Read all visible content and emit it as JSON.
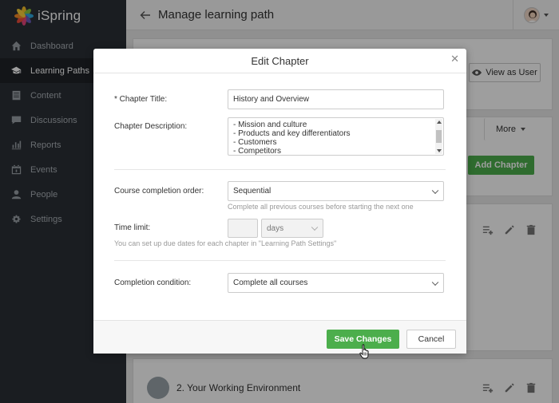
{
  "app": {
    "logo_text": "iSpring",
    "page_title": "Manage learning path"
  },
  "sidebar": {
    "items": [
      {
        "label": "Dashboard",
        "icon": "home-icon"
      },
      {
        "label": "Learning Paths",
        "icon": "graduation-cap-icon",
        "active": true
      },
      {
        "label": "Content",
        "icon": "document-icon"
      },
      {
        "label": "Discussions",
        "icon": "chat-icon"
      },
      {
        "label": "Reports",
        "icon": "bar-chart-icon"
      },
      {
        "label": "Events",
        "icon": "calendar-icon"
      },
      {
        "label": "People",
        "icon": "person-icon"
      },
      {
        "label": "Settings",
        "icon": "gear-icon"
      }
    ]
  },
  "background": {
    "view_as_user": "View as User",
    "more": "More",
    "add_chapter": "Add Chapter",
    "chapter2_title": "2. Your Working Environment"
  },
  "modal": {
    "title": "Edit Chapter",
    "chapter_title_label": "* Chapter Title:",
    "chapter_title_value": "History and Overview",
    "description_label": "Chapter Description:",
    "description_lines": [
      "- Mission and culture",
      "- Products and key differentiators",
      "- Customers",
      "- Competitors"
    ],
    "completion_order_label": "Course completion order:",
    "completion_order_value": "Sequential",
    "completion_order_hint": "Complete all previous courses before starting the next one",
    "time_limit_label": "Time limit:",
    "time_limit_unit": "days",
    "time_limit_hint": "You can set up due dates for each chapter in \"Learning Path Settings\"",
    "completion_condition_label": "Completion condition:",
    "completion_condition_value": "Complete all courses",
    "save_label": "Save Changes",
    "cancel_label": "Cancel"
  },
  "colors": {
    "accent_green": "#4cae4c",
    "sidebar_bg": "#2b3036"
  }
}
